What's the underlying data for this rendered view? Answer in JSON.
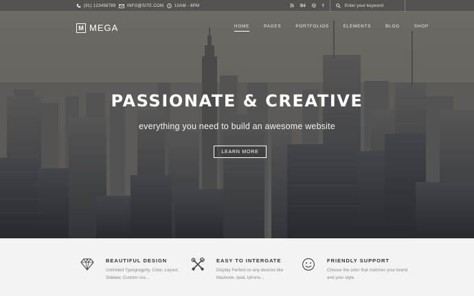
{
  "topbar": {
    "phone": "(91) 123456789",
    "email": "INFO@SITE.COM",
    "hours": "10AM - 6PM",
    "socials": [
      "rss",
      "Be",
      "dribbble",
      "f"
    ],
    "search_placeholder": "Enter your keyword"
  },
  "logo": {
    "mark": "M",
    "name": "MEGA"
  },
  "nav": {
    "items": [
      "HOME",
      "PAGES",
      "PORTFOLIOS",
      "ELEMENTS",
      "BLOG",
      "SHOP"
    ],
    "active": "HOME"
  },
  "hero": {
    "title": "PASSIONATE & CREATIVE",
    "subtitle": "everything you need to build an awesome website",
    "cta": "LEARN MORE"
  },
  "features": [
    {
      "icon": "diamond-icon",
      "title": "BEAUTIFUL DESIGN",
      "desc": "Unlimited Typogragphy, Color, Layout, Sidebar, Custom css..."
    },
    {
      "icon": "tools-icon",
      "title": "EASY TO INTERGATE",
      "desc": "Display Perfect on any devices like Macbook, Ipad, Iphone..."
    },
    {
      "icon": "smiley-icon",
      "title": "FRIENDLY SUPPORT",
      "desc": "Choose the color that matches your brand and your style."
    }
  ],
  "colors": {
    "accent": "#ffffff",
    "feature_bg": "#f3f3f3",
    "title_text": "#333333",
    "desc_text": "#888888"
  }
}
